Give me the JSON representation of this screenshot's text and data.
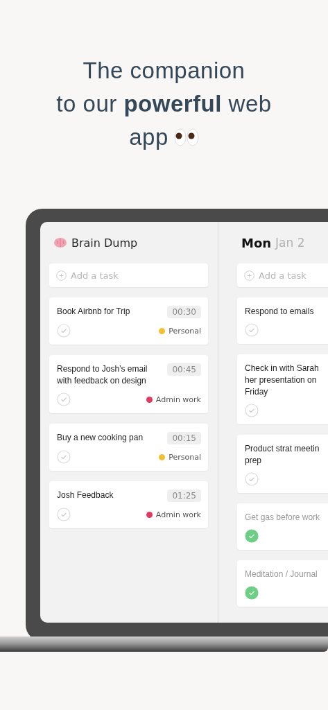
{
  "headline": {
    "line_1": "The companion",
    "line_2": "to our **powerful** web",
    "line_3": "app"
  },
  "columns": [
    {
      "kind": "list",
      "title": "Brain Dump",
      "add_placeholder": "Add a task",
      "tasks": [
        {
          "lines": [
            "Book Airbnb for Trip"
          ],
          "duration": "00:30",
          "tag": "Personal",
          "color": "#f2c037",
          "checked": false
        },
        {
          "lines": [
            "Respond to Josh’s email",
            "with feedback on design"
          ],
          "duration": "00:45",
          "tag": "Admin work",
          "color": "#e03a62",
          "checked": false
        },
        {
          "lines": [
            "Buy a new cooking pan"
          ],
          "duration": "00:15",
          "tag": "Personal",
          "color": "#f2c037",
          "checked": false
        },
        {
          "lines": [
            "Josh Feedback"
          ],
          "duration": "01:25",
          "tag": "Admin work",
          "color": "#e03a62",
          "checked": false
        }
      ]
    },
    {
      "kind": "day",
      "day": "Mon",
      "date": "Jan 2",
      "add_placeholder": "Add a task",
      "tasks": [
        {
          "lines": [
            "Respond to emails"
          ],
          "checked": false
        },
        {
          "lines": [
            "Check in with Sarah",
            "her presentation on",
            "Friday"
          ],
          "checked": false
        },
        {
          "lines": [
            "Product strat meetin",
            "prep"
          ],
          "checked": false
        },
        {
          "lines": [
            "Get gas before work"
          ],
          "checked": true
        },
        {
          "lines": [
            "Meditation / Journal"
          ],
          "checked": true
        }
      ]
    }
  ]
}
